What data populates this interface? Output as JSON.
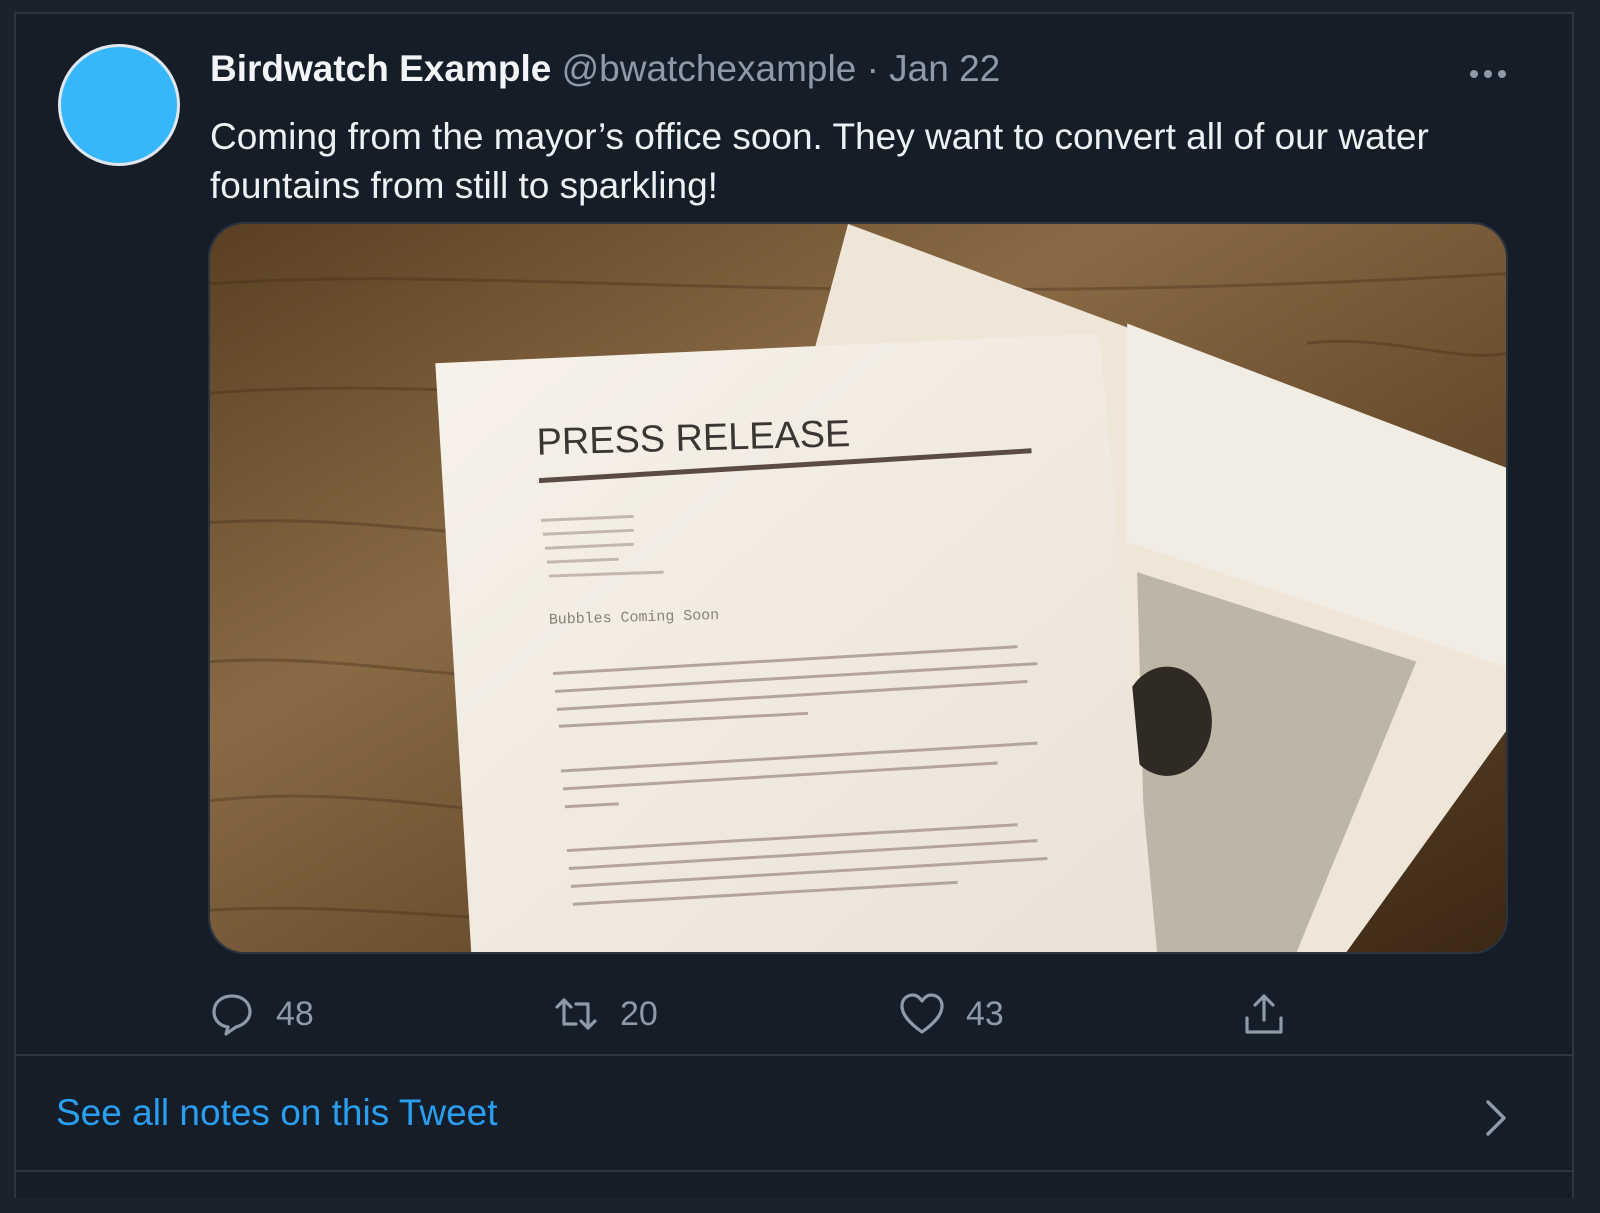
{
  "tweet": {
    "display_name": "Birdwatch Example",
    "handle": "@bwatchexample",
    "separator": "·",
    "date": "Jan 22",
    "text": "Coming from the mayor’s office soon. They want to convert all of our water fountains from still to sparkling!",
    "avatar_color": "#37b7fb",
    "more_icon": "ellipsis-icon",
    "media": {
      "document_title": "PRESS RELEASE",
      "document_subheading": "Bubbles Coming Soon"
    },
    "actions": {
      "reply_count": "48",
      "retweet_count": "20",
      "like_count": "43"
    }
  },
  "notes": {
    "link_label": "See all notes on this Tweet",
    "link_color": "#2a9ff0"
  },
  "colors": {
    "background": "#151d28",
    "muted_text": "#8e9aa7",
    "primary_text": "#eef1f4"
  }
}
